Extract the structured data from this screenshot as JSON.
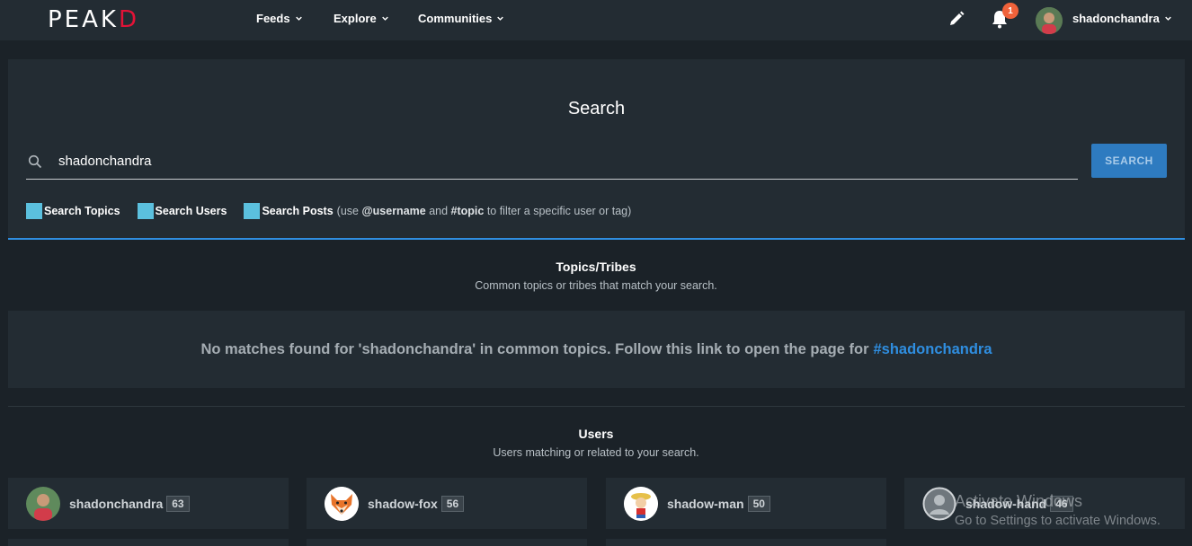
{
  "brand": {
    "logo_left": "PE",
    "logo_accent_a": "A",
    "logo_mid": "K",
    "logo_accent_d": "D",
    "accent_color": "#e31337"
  },
  "nav": {
    "items": [
      {
        "label": "Feeds"
      },
      {
        "label": "Explore"
      },
      {
        "label": "Communities"
      }
    ],
    "notifications_count": "1",
    "username": "shadonchandra"
  },
  "search": {
    "title": "Search",
    "query": "shadonchandra",
    "button_label": "SEARCH",
    "filters": [
      {
        "label": "Search Topics"
      },
      {
        "label": "Search Users"
      },
      {
        "label": "Search Posts"
      }
    ],
    "hint_prefix": "(use ",
    "hint_username": "@username",
    "hint_and": " and ",
    "hint_topic": "#topic",
    "hint_suffix": " to filter a specific user or tag)"
  },
  "topics": {
    "heading": "Topics/Tribes",
    "subheading": "Common topics or tribes that match your search.",
    "no_match_text": "No matches found for 'shadonchandra' in common topics. Follow this link to open the page for",
    "link_text": "#shadonchandra"
  },
  "users": {
    "heading": "Users",
    "subheading": "Users matching or related to your search.",
    "results": [
      {
        "name": "shadonchandra",
        "reputation": "63",
        "avatar": "profile-photo"
      },
      {
        "name": "shadow-fox",
        "reputation": "56",
        "avatar": "fox-icon"
      },
      {
        "name": "shadow-man",
        "reputation": "50",
        "avatar": "cartoon-face-icon"
      },
      {
        "name": "shadow-hand",
        "reputation": "46",
        "avatar": "default-user-icon"
      }
    ]
  },
  "os_watermark": {
    "line1": "Activate Windows",
    "line2": "Go to Settings to activate Windows."
  }
}
